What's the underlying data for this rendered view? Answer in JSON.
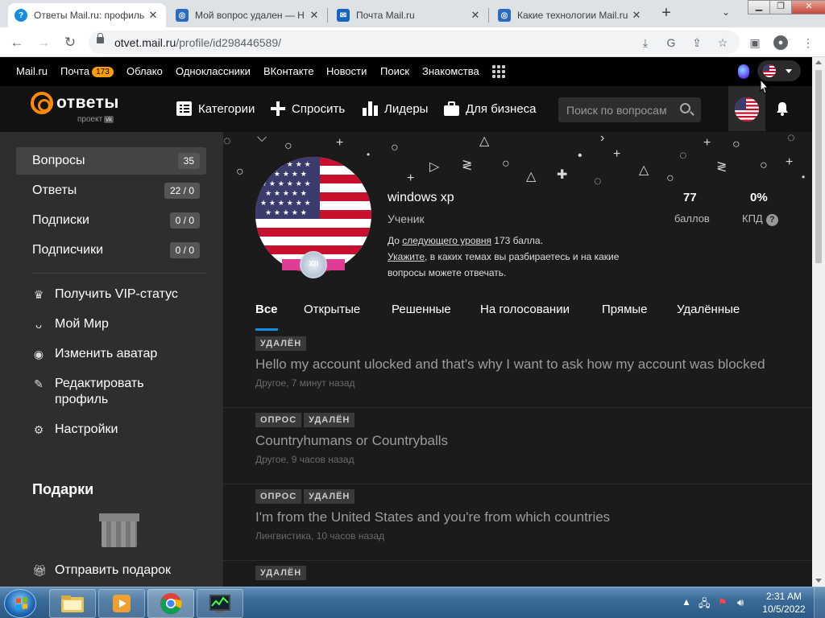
{
  "browser": {
    "tabs": [
      {
        "title": "Ответы Mail.ru: профиль",
        "active": true
      },
      {
        "title": "Мой вопрос удален — Н",
        "active": false
      },
      {
        "title": "Почта Mail.ru",
        "active": false
      },
      {
        "title": "Какие технологии Mail.ru",
        "active": false
      }
    ],
    "close_glyph": "✕",
    "new_tab_glyph": "+",
    "url_host": "otvet.mail.ru",
    "url_path": "/profile/id298446589/"
  },
  "portal": {
    "links": [
      "Mail.ru",
      "Почта",
      "Облако",
      "Одноклассники",
      "ВКонтакте",
      "Новости",
      "Поиск",
      "Знакомства"
    ],
    "mail_badge": "173"
  },
  "header": {
    "logo_text": "ответы",
    "logo_sub": "проект",
    "logo_vk": "vk",
    "nav": [
      "Категории",
      "Спросить",
      "Лидеры",
      "Для бизнеса"
    ],
    "search_placeholder": "Поиск по вопросам"
  },
  "sidebar": {
    "items": [
      {
        "label": "Вопросы",
        "count": "35"
      },
      {
        "label": "Ответы",
        "count": "22 / 0"
      },
      {
        "label": "Подписки",
        "count": "0 / 0"
      },
      {
        "label": "Подписчики",
        "count": "0 / 0"
      }
    ],
    "actions": [
      "Получить VIP-статус",
      "Мой Мир",
      "Изменить аватар",
      "Редактировать профиль",
      "Настройки"
    ],
    "gifts_title": "Подарки",
    "send_gift": "Отправить подарок"
  },
  "profile": {
    "name": "windows xp",
    "rank": "Ученик",
    "next_level_prefix": "До",
    "next_level_link": "следующего уровня",
    "next_level_suffix": "173 балла.",
    "hint_link": "Укажите",
    "hint_rest": ", в каких темах вы разбираетесь и на какие вопросы можете отвечать.",
    "badge": "XII",
    "points_value": "77",
    "points_label": "баллов",
    "kpd_value": "0%",
    "kpd_label": "КПД"
  },
  "tabs": [
    "Все",
    "Открытые",
    "Решенные",
    "На голосовании",
    "Прямые",
    "Удалённые"
  ],
  "questions": [
    {
      "tags": [
        "УДАЛЁН"
      ],
      "title": "Hello my account ulocked and that's why I want to ask how my account was blocked",
      "meta": "Другое, 7 минут назад"
    },
    {
      "tags": [
        "ОПРОС",
        "УДАЛЁН"
      ],
      "title": "Countryhumans or Countryballs",
      "meta": "Другое, 9 часов назад"
    },
    {
      "tags": [
        "ОПРОС",
        "УДАЛЁН"
      ],
      "title": "I'm from the United States and you're from which countries",
      "meta": "Лингвистика, 10 часов назад"
    },
    {
      "tags": [
        "УДАЛЁН"
      ],
      "title": "",
      "meta": ""
    }
  ],
  "taskbar": {
    "time": "2:31 AM",
    "date": "10/5/2022"
  },
  "colors": {
    "accent_orange": "#ff8a00",
    "tab_underline": "#168de2",
    "sidebar_bg": "#2e2e2e",
    "main_bg": "#1b1b1b"
  },
  "icons": [
    "search-icon",
    "bell-icon",
    "categories-icon",
    "plus-icon",
    "leaders-icon",
    "business-icon",
    "crown-icon",
    "myworld-icon",
    "camera-icon",
    "edit-icon",
    "gear-icon",
    "gift-icon",
    "apps-grid-icon",
    "marusia-icon",
    "us-flag-icon"
  ]
}
